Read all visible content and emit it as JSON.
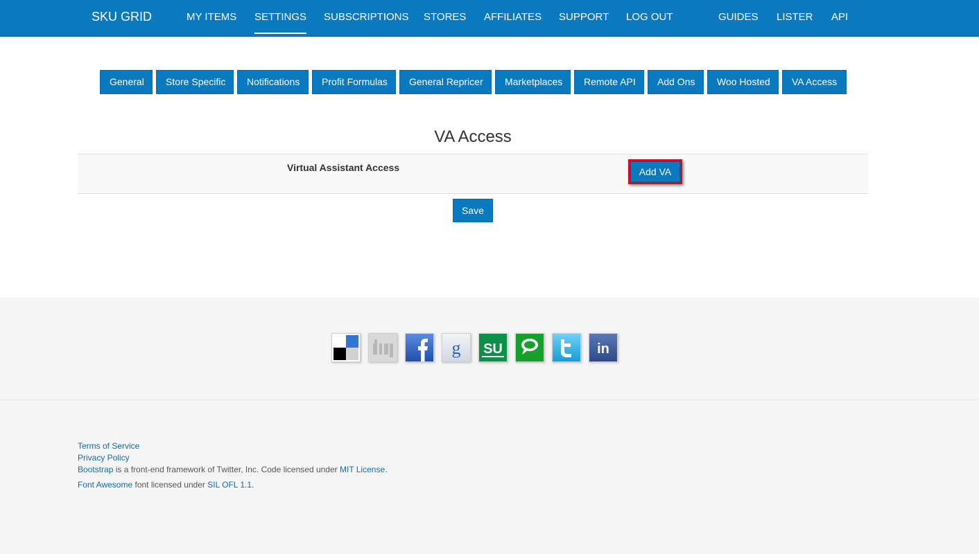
{
  "navbar": {
    "brand": "SKU GRID",
    "links": [
      "MY ITEMS",
      "SETTINGS",
      "SUBSCRIPTIONS",
      "STORES",
      "AFFILIATES",
      "SUPPORT",
      "LOG OUT",
      "GUIDES",
      "LISTER",
      "API"
    ],
    "active": "SETTINGS"
  },
  "tabs": [
    "General",
    "Store Specific",
    "Notifications",
    "Profit Formulas",
    "General Repricer",
    "Marketplaces",
    "Remote API",
    "Add Ons",
    "Woo Hosted",
    "VA Access"
  ],
  "page": {
    "title": "VA Access",
    "row_label": "Virtual Assistant Access",
    "add_button": "Add VA",
    "save_button": "Save"
  },
  "social_icons": [
    "delicious-icon",
    "digg-icon",
    "facebook-icon",
    "google-icon",
    "stumbleupon-icon",
    "technorati-icon",
    "twitter-icon",
    "linkedin-icon"
  ],
  "footer": {
    "terms": "Terms of Service",
    "privacy": "Privacy Policy",
    "bootstrap_link": "Bootstrap",
    "bootstrap_text": " is a front-end framework of Twitter, Inc. Code licensed under ",
    "mit_link": "MIT License",
    "period1": ".",
    "fa_link": "Font Awesome",
    "fa_text": " font licensed under ",
    "sil_link": "SIL OFL 1.1",
    "period2": "."
  },
  "colors": {
    "primary": "#0a79c0",
    "highlight_border": "#c8102e",
    "footer_bg": "#f5f5f5"
  }
}
